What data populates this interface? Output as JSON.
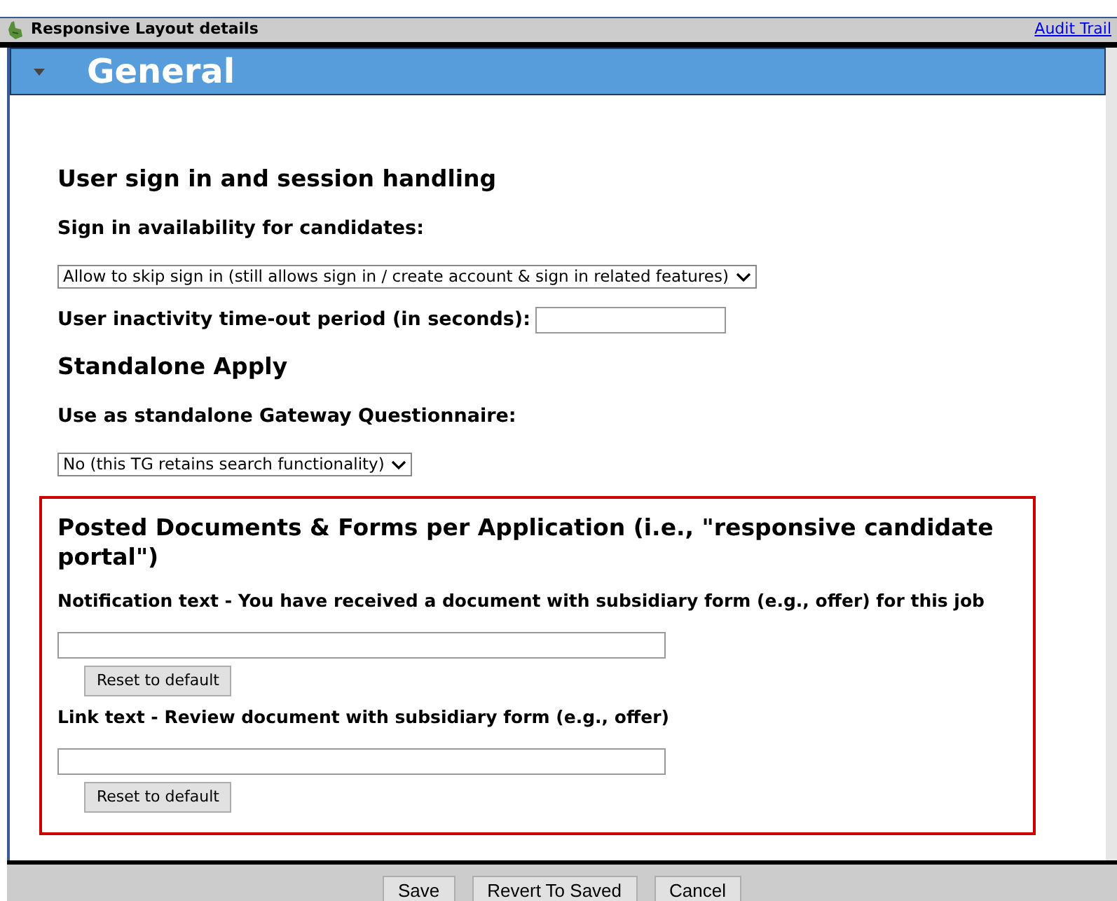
{
  "window": {
    "title": "Responsive Layout details",
    "link": "Audit Trail"
  },
  "section": {
    "title": "General",
    "expanded": true
  },
  "groups": [
    {
      "heading": "User sign in and session handling",
      "fields": [
        {
          "kind": "select",
          "label": "Sign in availability for candidates:",
          "value": "Allow to skip sign in (still allows sign in / create account & sign in related features)"
        },
        {
          "kind": "inline-text",
          "label": "User inactivity time-out period (in seconds):"
        }
      ]
    },
    {
      "heading": "Standalone Apply",
      "fields": [
        {
          "kind": "select",
          "label": "Use as standalone Gateway Questionnaire:",
          "value": "No (this TG retains search functionality)"
        }
      ]
    }
  ],
  "highlighted": {
    "heading": "Posted Documents & Forms per Application (i.e., \"responsive candidate portal\")",
    "fields": [
      {
        "label": "Notification text - You have received a document with subsidiary form (e.g., offer) for this job",
        "button": "Reset to default"
      },
      {
        "label": "Link text - Review document with subsidiary form (e.g., offer)",
        "button": "Reset to default"
      }
    ]
  },
  "footer": {
    "buttons": [
      "Save",
      "Revert To Saved",
      "Cancel"
    ]
  }
}
